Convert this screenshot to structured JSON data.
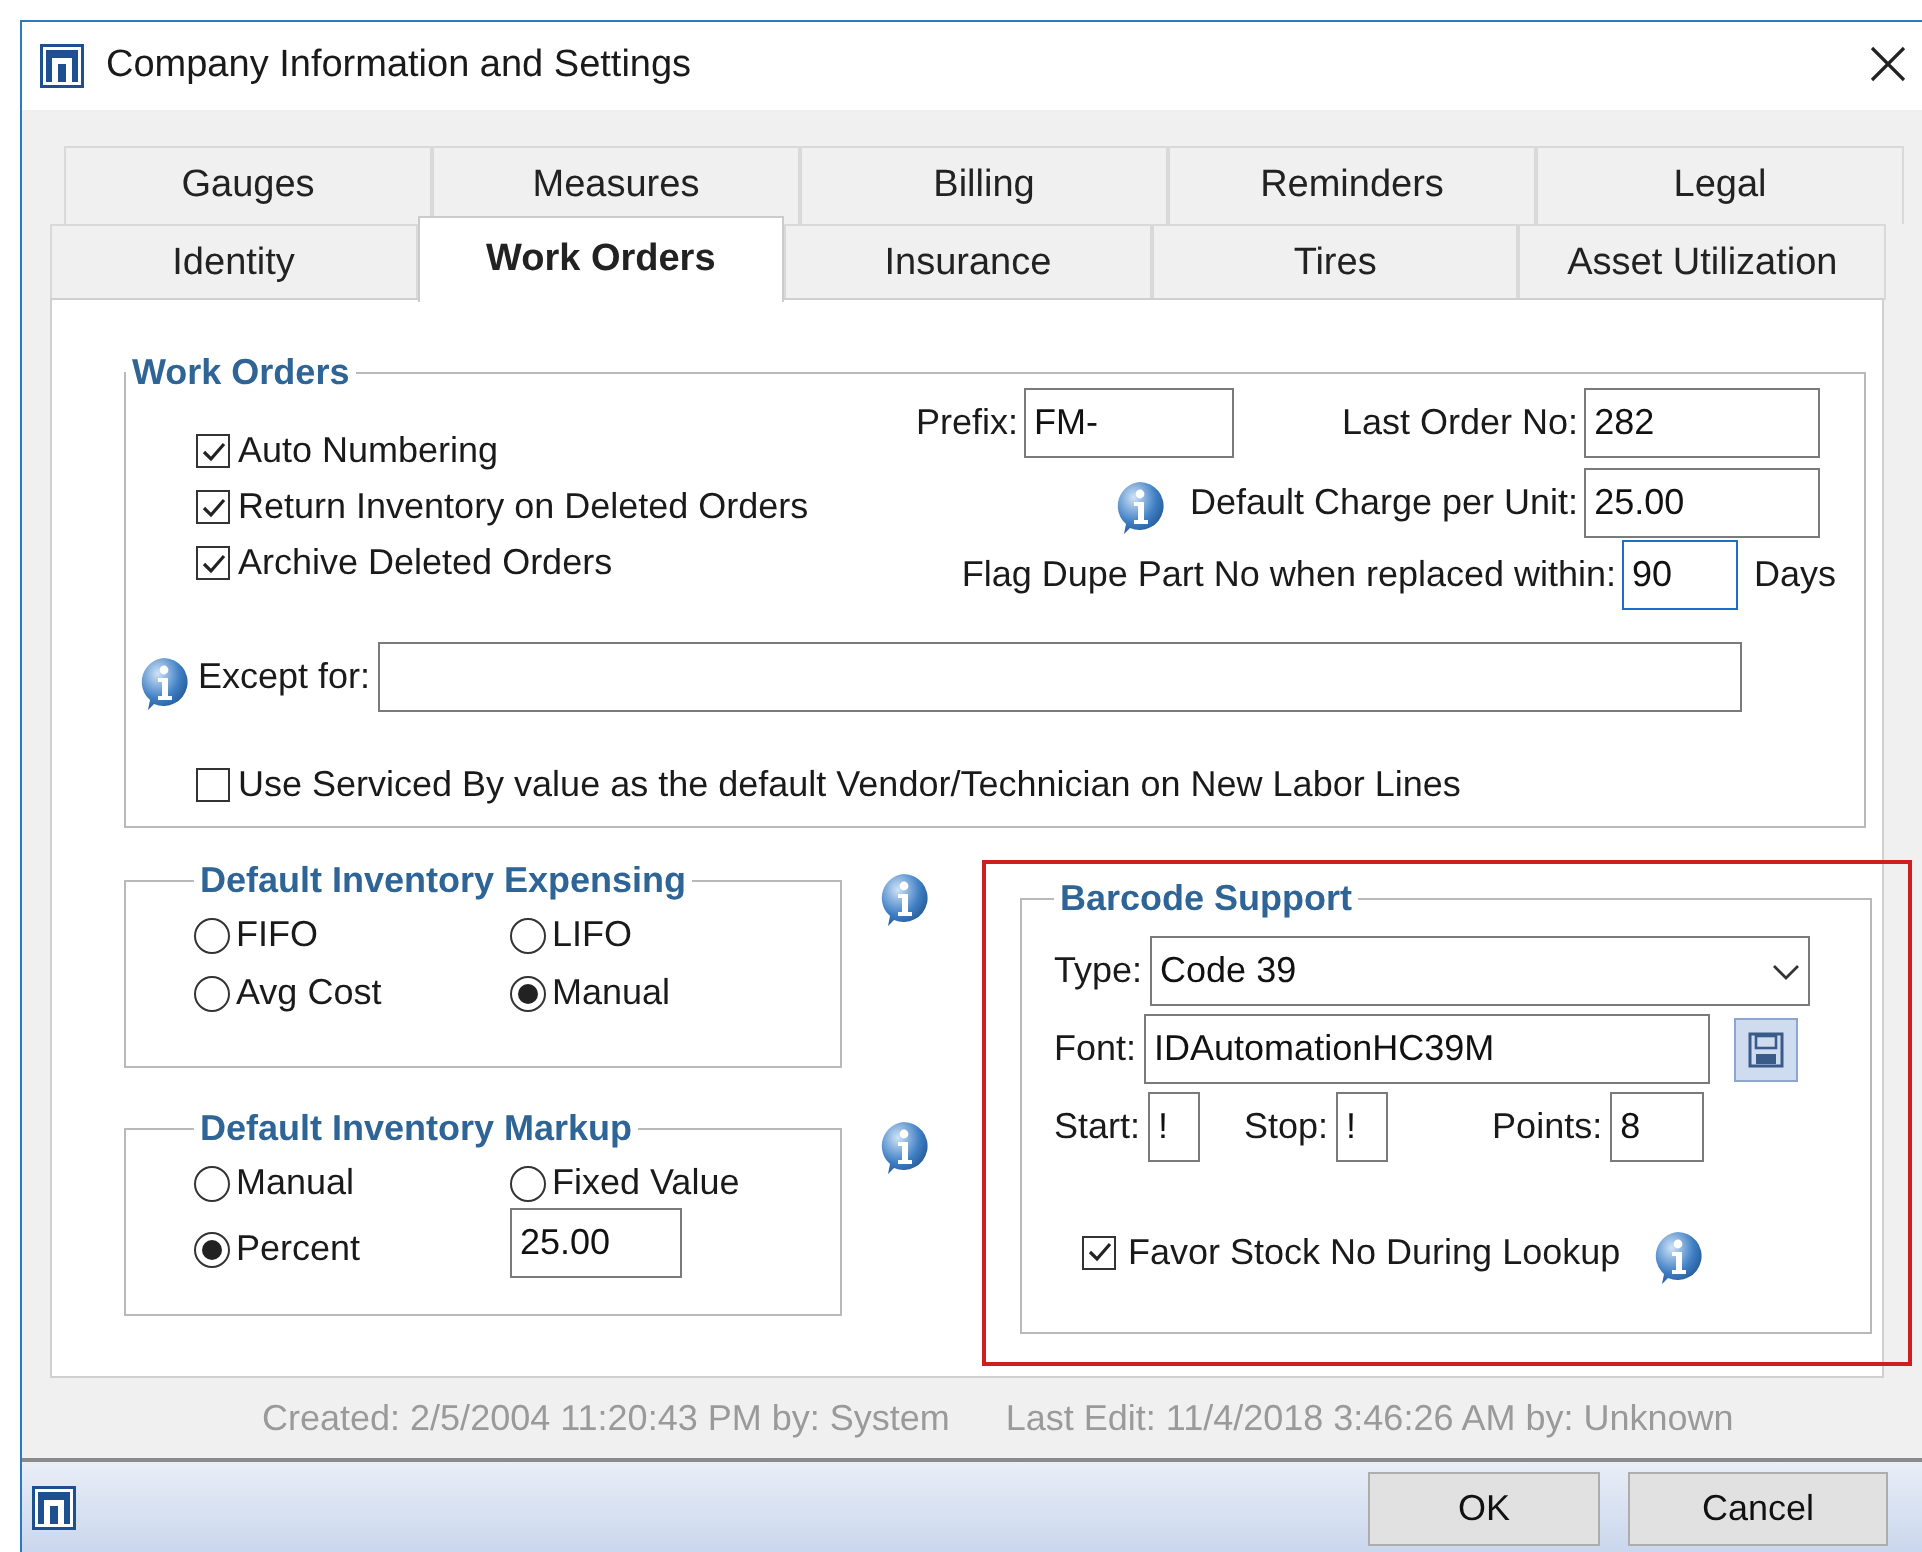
{
  "window": {
    "title": "Company Information and Settings"
  },
  "tab_rows": [
    {
      "tabs": [
        {
          "label": "Gauges",
          "selected": false
        },
        {
          "label": "Measures",
          "selected": false
        },
        {
          "label": "Billing",
          "selected": false
        },
        {
          "label": "Reminders",
          "selected": false
        },
        {
          "label": "Legal",
          "selected": false
        }
      ]
    },
    {
      "tabs": [
        {
          "label": "Identity",
          "selected": false
        },
        {
          "label": "Work Orders",
          "selected": true
        },
        {
          "label": "Insurance",
          "selected": false
        },
        {
          "label": "Tires",
          "selected": false
        },
        {
          "label": "Asset Utilization",
          "selected": false
        }
      ]
    }
  ],
  "work_orders": {
    "title": "Work Orders",
    "checkboxes": [
      {
        "label": "Auto Numbering",
        "checked": true
      },
      {
        "label": "Return Inventory on Deleted Orders",
        "checked": true
      },
      {
        "label": "Archive Deleted Orders",
        "checked": true
      }
    ],
    "prefix": {
      "label": "Prefix:",
      "value": "FM-"
    },
    "last_order_no": {
      "label": "Last Order No:",
      "value": "282"
    },
    "default_charge": {
      "label": "Default Charge per Unit:",
      "value": "25.00"
    },
    "flag_dupe": {
      "label": "Flag Dupe Part No when replaced within:",
      "value": "90",
      "focused": true,
      "suffix": "Days"
    },
    "except_for": {
      "label": "Except for:"
    },
    "serviced_by": {
      "label": "Use Serviced By value as the default Vendor/Technician on New Labor Lines",
      "checked": false
    }
  },
  "expensing": {
    "title": "Default Inventory Expensing",
    "options": [
      {
        "label": "FIFO",
        "selected": false
      },
      {
        "label": "LIFO",
        "selected": false
      },
      {
        "label": "Avg Cost",
        "selected": false
      },
      {
        "label": "Manual",
        "selected": true
      }
    ]
  },
  "markup": {
    "title": "Default Inventory Markup",
    "options": [
      {
        "label": "Manual",
        "selected": false
      },
      {
        "label": "Fixed Value",
        "selected": false
      },
      {
        "label": "Percent",
        "selected": true
      }
    ],
    "value": "25.00"
  },
  "barcode": {
    "title": "Barcode Support",
    "type": {
      "label": "Type:",
      "value": "Code 39"
    },
    "font": {
      "label": "Font:",
      "value": "IDAutomationHC39M"
    },
    "start": {
      "label": "Start:",
      "value": "!"
    },
    "stop": {
      "label": "Stop:",
      "value": "!"
    },
    "points": {
      "label": "Points:",
      "value": "8"
    },
    "favor": {
      "label": "Favor Stock No During Lookup",
      "checked": true
    }
  },
  "footer": {
    "created": "Created: 2/5/2004 11:20:43 PM by: System",
    "last_edit": "Last Edit: 11/4/2018 3:46:26 AM by: Unknown"
  },
  "buttons": [
    "OK",
    "Cancel"
  ]
}
